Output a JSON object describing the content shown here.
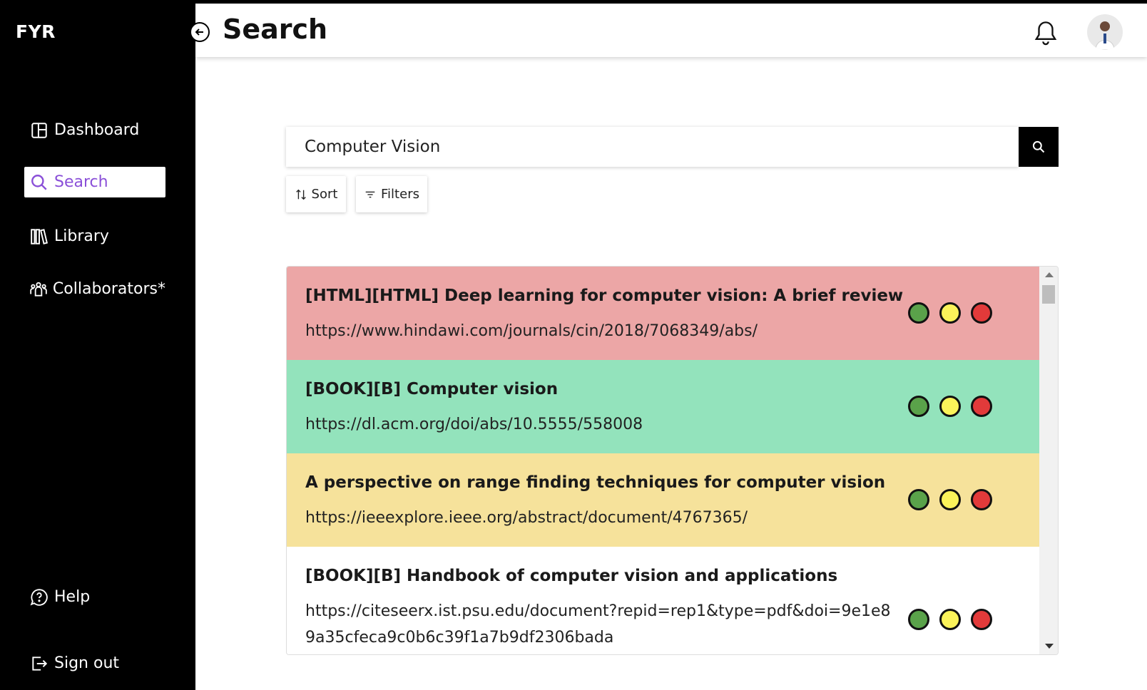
{
  "sidebar": {
    "brand": "FYR",
    "items": [
      {
        "label": "Dashboard",
        "icon": "dashboard-icon",
        "active": false
      },
      {
        "label": "Search",
        "icon": "search-icon",
        "active": true
      },
      {
        "label": "Library",
        "icon": "library-icon",
        "active": false
      },
      {
        "label": "Collaborators*",
        "icon": "collaborators-icon",
        "active": false
      }
    ],
    "bottom_items": [
      {
        "label": "Help",
        "icon": "help-icon"
      },
      {
        "label": "Sign out",
        "icon": "sign-out-icon"
      }
    ]
  },
  "header": {
    "title": "Search"
  },
  "search": {
    "value": "Computer Vision",
    "sort_label": "Sort",
    "filters_label": "Filters"
  },
  "results": [
    {
      "title": "[HTML][HTML] Deep learning for computer vision: A brief review",
      "url": "https://www.hindawi.com/journals/cin/2018/7068349/abs/",
      "bg": "#eca6a6"
    },
    {
      "title": "[BOOK][B] Computer vision",
      "url": "https://dl.acm.org/doi/abs/10.5555/558008",
      "bg": "#93e3bc"
    },
    {
      "title": "A perspective on range finding techniques for computer vision",
      "url": "https://ieeexplore.ieee.org/abstract/document/4767365/",
      "bg": "#f6e29b"
    },
    {
      "title": "[BOOK][B] Handbook of computer vision and applications",
      "url": "https://citeseerx.ist.psu.edu/document?repid=rep1&type=pdf&doi=9e1e89a35cfeca9c0b6c39f1a7b9df2306bada",
      "bg": "#ffffff"
    }
  ],
  "rating_colors": {
    "green": "#5aa24a",
    "yellow": "#fbf35a",
    "red": "#e23a3a"
  }
}
